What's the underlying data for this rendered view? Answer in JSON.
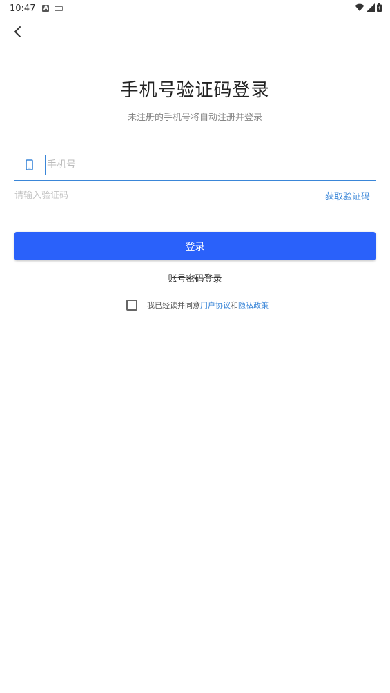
{
  "status_bar": {
    "time": "10:47",
    "icons": [
      "a-notification-icon",
      "keyboard-icon",
      "wifi-icon",
      "signal-icon",
      "battery-icon"
    ]
  },
  "header": {
    "back_icon": "chevron-left-icon"
  },
  "page": {
    "title": "手机号验证码登录",
    "subtitle": "未注册的手机号将自动注册并登录"
  },
  "form": {
    "phone_placeholder": "手机号",
    "phone_value": "",
    "code_placeholder": "请输入验证码",
    "code_value": "",
    "get_code_label": "获取验证码",
    "login_label": "登录"
  },
  "alt_login": {
    "label": "账号密码登录"
  },
  "agreement": {
    "checked": false,
    "prefix": "我已经读并同意",
    "user_agreement": "用户协议",
    "and": "和",
    "privacy_policy": "隐私政策"
  },
  "colors": {
    "accent": "#3a86d8",
    "button": "#2a61fa"
  }
}
